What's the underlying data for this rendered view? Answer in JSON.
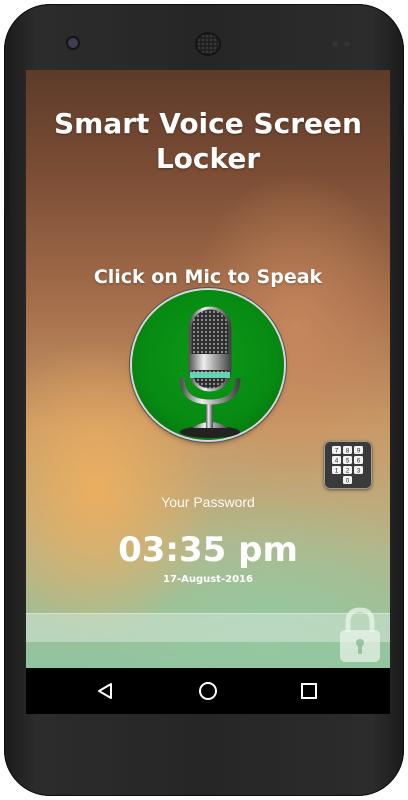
{
  "app": {
    "title": "Smart Voice Screen Locker",
    "prompt": "Click on Mic to Speak",
    "password_label": "Your Password",
    "time": "03:35 pm",
    "date": "17-August-2016"
  },
  "keypad": {
    "keys": [
      "7",
      "8",
      "9",
      "4",
      "5",
      "6",
      "1",
      "2",
      "3",
      "0"
    ]
  },
  "navbar": {
    "items": [
      "back",
      "home",
      "recent-apps"
    ]
  },
  "colors": {
    "mic_button": "#078a12",
    "text": "#ffffff",
    "navbar": "#000000"
  }
}
